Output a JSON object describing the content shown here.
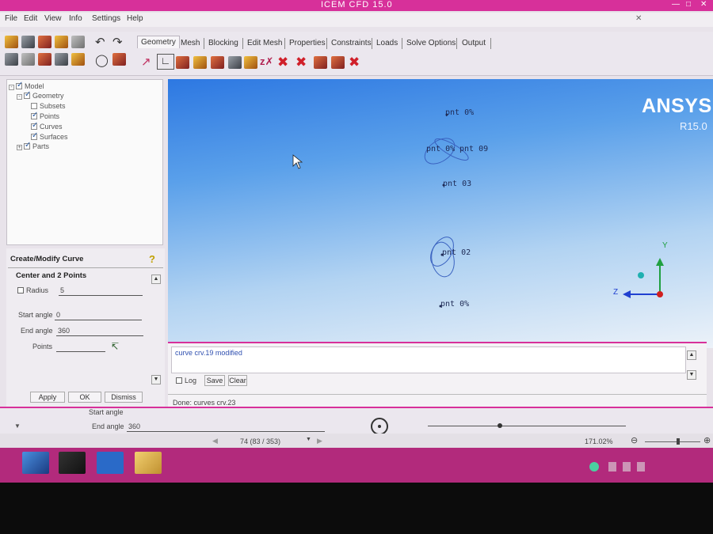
{
  "window": {
    "title": "ICEM CFD 15.0"
  },
  "menu": [
    "File",
    "Edit",
    "View",
    "Info",
    "Settings",
    "Help"
  ],
  "tabs": [
    "Geometry",
    "Mesh",
    "Blocking",
    "Edit Mesh",
    "Properties",
    "Constraints",
    "Loads",
    "Solve Options",
    "Output"
  ],
  "tree": {
    "model": "Model",
    "geometry": "Geometry",
    "subsets": "Subsets",
    "points": "Points",
    "curves": "Curves",
    "surfaces": "Surfaces",
    "parts": "Parts"
  },
  "form": {
    "title": "Create/Modify Curve",
    "group": "Center and 2 Points",
    "radius_label": "Radius",
    "radius_value": "5",
    "start_label": "Start angle",
    "start_value": "0",
    "end_label": "End angle",
    "end_value": "360",
    "points_label": "Points",
    "apply": "Apply",
    "ok": "OK",
    "dismiss": "Dismiss"
  },
  "viewport": {
    "logo": "ANSYS",
    "version": "R15.0",
    "points": [
      "pnt 0%",
      "pnt 0%",
      "pnt 09",
      "pnt 03",
      "pnt 02",
      "pnt 0%"
    ],
    "axis_y": "Y",
    "axis_z": "Z"
  },
  "messages": {
    "line1": "curve crv.19 modified",
    "log": "Log",
    "save": "Save",
    "clear": "Clear",
    "status": "Done: curves crv.23"
  },
  "bottom": {
    "start_label": "Start angle",
    "end_label": "End angle",
    "end_value": "360",
    "counter": "74 (83 / 353)",
    "zoom": "171.02%"
  },
  "colors": {
    "accent": "#d7309a",
    "viewport_top": "#2d78e2",
    "viewport_bottom": "#ecf2f9"
  }
}
